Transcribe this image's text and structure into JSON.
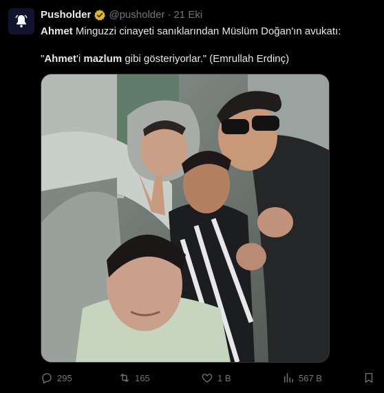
{
  "tweet": {
    "author": {
      "display_name": "Pusholder",
      "handle": "@pusholder",
      "separator": "·",
      "date": "21 Eki",
      "avatar_icon": "bell-icon",
      "verified_icon": "verified-badge-icon",
      "verified_color": "#e2b719"
    },
    "line1_bold": "Ahmet",
    "line1_rest": " Minguzzi cinayeti sanıklarından Müslüm Doğan'ın avukatı:",
    "line2_open_quote": "\"",
    "line2_bold_1": "Ahmet",
    "line2_mid": "'i ",
    "line2_bold_2": "mazlum",
    "line2_rest": " gibi gösteriyorlar.\" (Emrullah Erdinç)",
    "media": {
      "icon": "photo-group-selfie"
    },
    "actions": {
      "replies": {
        "icon": "reply-icon",
        "count": "295"
      },
      "reposts": {
        "icon": "repost-icon",
        "count": "165"
      },
      "likes": {
        "icon": "heart-icon",
        "count": "1 B"
      },
      "views": {
        "icon": "views-icon",
        "count": "567 B"
      },
      "bookmark": {
        "icon": "bookmark-icon"
      }
    },
    "colors": {
      "background": "#000000",
      "text": "#e7e9ea",
      "muted": "#71767b"
    }
  }
}
